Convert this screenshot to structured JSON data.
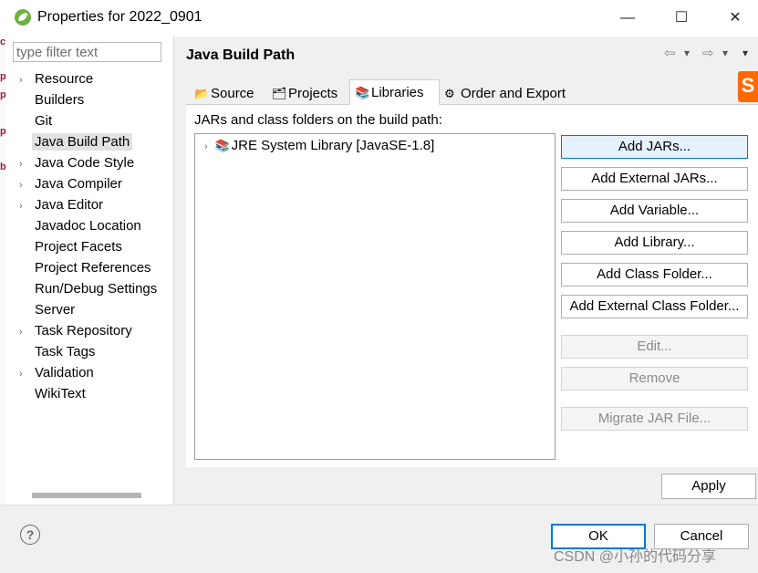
{
  "window": {
    "title": "Properties for 2022_0901",
    "minimize": "—",
    "maximize": "☐",
    "close": "✕"
  },
  "left_strip_glyphs": [
    "c",
    "p",
    "p",
    "p",
    "b"
  ],
  "filter": {
    "placeholder": "type filter text",
    "value": ""
  },
  "nav": {
    "items": [
      {
        "label": "Resource",
        "expandable": true,
        "selected": false
      },
      {
        "label": "Builders",
        "expandable": false,
        "selected": false
      },
      {
        "label": "Git",
        "expandable": false,
        "selected": false
      },
      {
        "label": "Java Build Path",
        "expandable": false,
        "selected": true
      },
      {
        "label": "Java Code Style",
        "expandable": true,
        "selected": false
      },
      {
        "label": "Java Compiler",
        "expandable": true,
        "selected": false
      },
      {
        "label": "Java Editor",
        "expandable": true,
        "selected": false
      },
      {
        "label": "Javadoc Location",
        "expandable": false,
        "selected": false
      },
      {
        "label": "Project Facets",
        "expandable": false,
        "selected": false
      },
      {
        "label": "Project References",
        "expandable": false,
        "selected": false
      },
      {
        "label": "Run/Debug Settings",
        "expandable": false,
        "selected": false
      },
      {
        "label": "Server",
        "expandable": false,
        "selected": false
      },
      {
        "label": "Task Repository",
        "expandable": true,
        "selected": false
      },
      {
        "label": "Task Tags",
        "expandable": false,
        "selected": false
      },
      {
        "label": "Validation",
        "expandable": true,
        "selected": false
      },
      {
        "label": "WikiText",
        "expandable": false,
        "selected": false
      }
    ],
    "chevron": "›"
  },
  "page": {
    "title": "Java Build Path",
    "back_icon": "⇦",
    "forward_icon": "⇨",
    "menu_icon": "▾",
    "brand_glyph": "S",
    "brand_color": "#ff6a00"
  },
  "tabs": [
    {
      "label": "Source",
      "icon": "📂",
      "active": false
    },
    {
      "label": "Projects",
      "icon": "🗂",
      "active": false
    },
    {
      "label": "Libraries",
      "icon": "📚",
      "active": true
    },
    {
      "label": "Order and Export",
      "icon": "⚙",
      "active": false
    }
  ],
  "libraries": {
    "section_label": "JARs and class folders on the build path:",
    "items": [
      {
        "label": "JRE System Library [JavaSE-1.8]",
        "icon": "📚",
        "chevron": "›"
      }
    ]
  },
  "buttons": {
    "add_jars": "Add JARs...",
    "add_external_jars": "Add External JARs...",
    "add_variable": "Add Variable...",
    "add_library": "Add Library...",
    "add_class_folder": "Add Class Folder...",
    "add_external_class_folder": "Add External Class Folder...",
    "edit": "Edit...",
    "remove": "Remove",
    "migrate_jar": "Migrate JAR File..."
  },
  "footer": {
    "apply": "Apply",
    "ok": "OK",
    "cancel": "Cancel",
    "help": "?",
    "watermark": "CSDN @小孙的代码分享"
  },
  "colors": {
    "accent": "#0078d7",
    "focus_fill": "#e5f1fb",
    "selection": "#e1e1e1",
    "app_icon_green": "#6db33f"
  }
}
